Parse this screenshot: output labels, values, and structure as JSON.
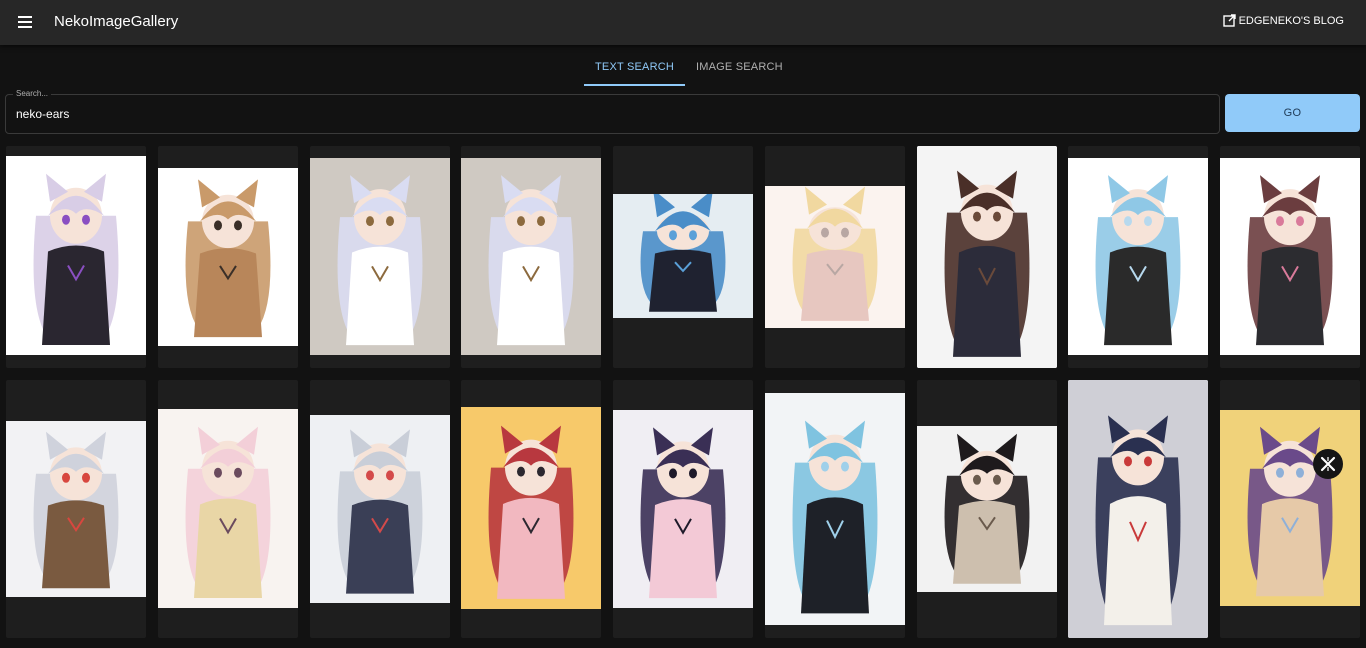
{
  "app": {
    "title": "NekoImageGallery",
    "blog_link": "EDGENEKO'S BLOG"
  },
  "tabs": [
    {
      "label": "TEXT SEARCH",
      "active": true
    },
    {
      "label": "IMAGE SEARCH",
      "active": false
    }
  ],
  "search": {
    "label": "Search...",
    "value": "neko-ears"
  },
  "go_button": {
    "label": "GO"
  },
  "colors": {
    "accent": "#90caf9",
    "appbar": "#272727",
    "background": "#121212",
    "card": "#1e1e1e"
  },
  "images": [
    {
      "name": "gallery-image-1",
      "palette": [
        "#ffffff",
        "#d8cde6",
        "#2a2630",
        "#8a4fc2"
      ]
    },
    {
      "name": "gallery-image-2",
      "palette": [
        "#ffffff",
        "#c99a6a",
        "#b8865a",
        "#3a2f28"
      ]
    },
    {
      "name": "gallery-image-3",
      "palette": [
        "#cfc9c2",
        "#d9dcf2",
        "#ffffff",
        "#8c6a3e"
      ]
    },
    {
      "name": "gallery-image-4",
      "palette": [
        "#cfc9c2",
        "#d9dcf2",
        "#ffffff",
        "#8c6a3e"
      ]
    },
    {
      "name": "gallery-image-5",
      "palette": [
        "#e5edf2",
        "#4a8dc8",
        "#1f2230",
        "#5aa0d8"
      ]
    },
    {
      "name": "gallery-image-6",
      "palette": [
        "#fbf3ef",
        "#f1d8a0",
        "#e7c7c0",
        "#b8a7a3"
      ]
    },
    {
      "name": "gallery-image-7",
      "palette": [
        "#f4f4f4",
        "#4a2f28",
        "#2c2c3a",
        "#6a4a3a"
      ]
    },
    {
      "name": "gallery-image-8",
      "palette": [
        "#ffffff",
        "#8fc8e6",
        "#2a2a2a",
        "#b7d9ee"
      ]
    },
    {
      "name": "gallery-image-9",
      "palette": [
        "#ffffff",
        "#6b3d3f",
        "#2c2c30",
        "#d97a9a"
      ]
    },
    {
      "name": "gallery-image-10",
      "palette": [
        "#f2f2f4",
        "#cfd2dc",
        "#7a5a40",
        "#d8473f"
      ]
    },
    {
      "name": "gallery-image-11",
      "palette": [
        "#f8f3f0",
        "#f3cfd8",
        "#e9d6a6",
        "#6b4b5e"
      ]
    },
    {
      "name": "gallery-image-12",
      "palette": [
        "#eef0f3",
        "#c9ced8",
        "#3a3f56",
        "#d44a4a"
      ]
    },
    {
      "name": "gallery-image-13",
      "palette": [
        "#f7c96a",
        "#b8383f",
        "#f2b8c0",
        "#2c2830"
      ]
    },
    {
      "name": "gallery-image-14",
      "palette": [
        "#f0eef3",
        "#3a2f55",
        "#f3c9d6",
        "#1e1a2a"
      ]
    },
    {
      "name": "gallery-image-15",
      "palette": [
        "#f2f4f6",
        "#7fc3e0",
        "#1e2128",
        "#9fd0ea"
      ]
    },
    {
      "name": "gallery-image-16",
      "palette": [
        "#f2f2f2",
        "#1e1a1c",
        "#cdbfae",
        "#6a5a4c"
      ]
    },
    {
      "name": "gallery-image-17",
      "palette": [
        "#cfcfd6",
        "#2a3050",
        "#f3f0ea",
        "#c93a3a"
      ]
    },
    {
      "name": "gallery-image-18",
      "palette": [
        "#f0d27a",
        "#6a4a8a",
        "#e6c9a8",
        "#8fb0d8"
      ]
    }
  ]
}
